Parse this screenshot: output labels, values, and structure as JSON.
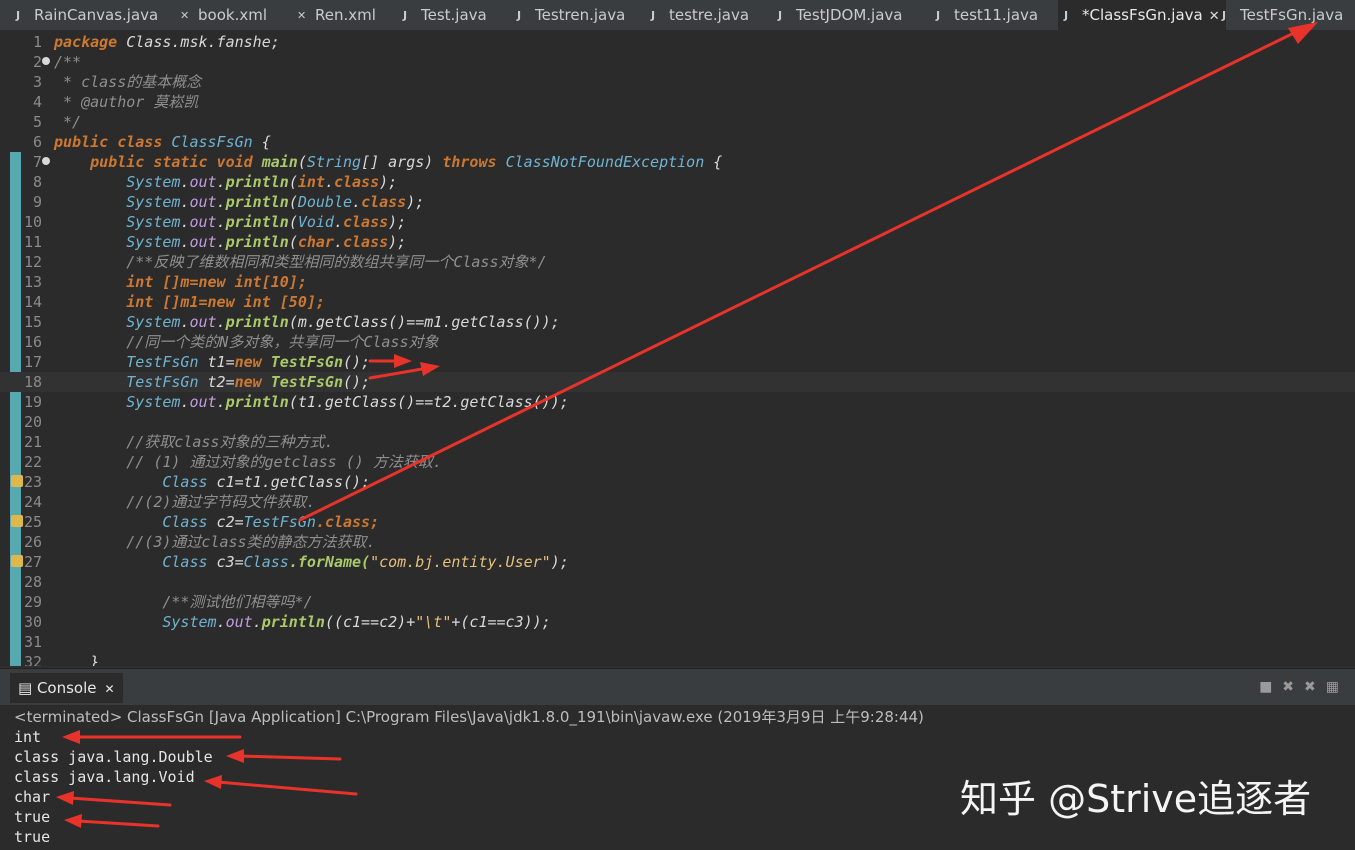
{
  "tabs": [
    {
      "label": "RainCanvas.java",
      "icon": "java-file-icon"
    },
    {
      "label": "book.xml",
      "icon": "xml-file-icon"
    },
    {
      "label": "Ren.xml",
      "icon": "xml-file-icon"
    },
    {
      "label": "Test.java",
      "icon": "java-file-icon"
    },
    {
      "label": "Testren.java",
      "icon": "java-file-icon"
    },
    {
      "label": "testre.java",
      "icon": "java-file-icon"
    },
    {
      "label": "TestJDOM.java",
      "icon": "java-file-icon"
    },
    {
      "label": "test11.java",
      "icon": "java-file-icon"
    },
    {
      "label": "*ClassFsGn.java",
      "icon": "java-file-icon",
      "active": true
    },
    {
      "label": "TestFsGn.java",
      "icon": "java-file-icon"
    }
  ],
  "editor": {
    "line_numbers": [
      "1",
      "2",
      "3",
      "4",
      "5",
      "6",
      "7",
      "8",
      "9",
      "10",
      "11",
      "12",
      "13",
      "14",
      "15",
      "16",
      "17",
      "18",
      "19",
      "20",
      "21",
      "22",
      "23",
      "24",
      "25",
      "26",
      "27",
      "28",
      "29",
      "30",
      "31",
      "32"
    ],
    "code": {
      "l1_a": "package ",
      "l1_b": "Class.msk.fanshe;",
      "l2": "/**",
      "l3": " * class的基本概念",
      "l4": " * @author 莫崧凯",
      "l5": " */",
      "l6_a": "public class ",
      "l6_b": "ClassFsGn",
      " l6_c": " {",
      "l7_a": "    public static void ",
      "l7_b": "main",
      "l7_c": "(",
      "l7_d": "String",
      "l7_e": "[] args) ",
      "l7_f": "throws ",
      "l7_g": "ClassNotFoundException",
      "l7_h": " {",
      "sys": "System",
      "out": "out",
      "println": "println",
      "l8_arg": "int",
      "l9_arg": "Double",
      "l10_arg": "Void",
      "l11_arg": "char",
      "kclass": "class",
      "l12": "/**反映了维数相同和类型相同的数组共享同一个Class对象*/",
      "l13": "int []m=new int[10];",
      "l13_n": "10",
      "l14": "int []m1=new int [50];",
      "l14_n": "50",
      "l15": "m.getClass()==m1.getClass());",
      "l16": "//同一个类的N多对象，共享同一个Class对象",
      "l17_a": "TestFsGn",
      " l17_b": " t1=",
      "new": "new ",
      "l17_c": "TestFsGn",
      "l17_d": "();",
      "l18_b": " t2=",
      "l19": "t1.getClass()==t2.getClass());",
      "l21": "//获取class对象的三种方式.",
      "l22": "// (1) 通过对象的getclass () 方法获取.",
      "l23_a": "Class",
      " l23_b": " c1=t1.getClass();",
      "l24": "//(2)通过字节码文件获取.",
      "l25_a": "Class",
      " l25_b": " c2=",
      "l25_c": "TestFsGn",
      ".class": ".class;",
      "l26": "//(3)通过class类的静态方法获取.",
      "l27_a": "Class",
      " l27_b": " c3=",
      "l27_c": "Class",
      ".forName": ".forName(",
      "l27_s": "\"com.bj.entity.User\"",
      "l27_e": ");",
      "l29": "/**测试他们相等吗*/",
      "l30_a": "((c1==c2)+",
      "l30_s": "\"\\t\"",
      "l30_b": "+(c1==c3));",
      "l32": "}"
    }
  },
  "console": {
    "tab_label": "Console",
    "terminated": "<terminated> ClassFsGn [Java Application] C:\\Program Files\\Java\\jdk1.8.0_191\\bin\\javaw.exe (2019年3月9日 上午9:28:44)",
    "output": [
      "int",
      "class java.lang.Double",
      "class java.lang.Void",
      "char",
      "true",
      "true"
    ]
  },
  "watermark": "知乎 @Strive追逐者",
  "colors": {
    "arrow": "#e8332a",
    "gutter": "#57a8b0",
    "keyword": "#cc7832"
  }
}
